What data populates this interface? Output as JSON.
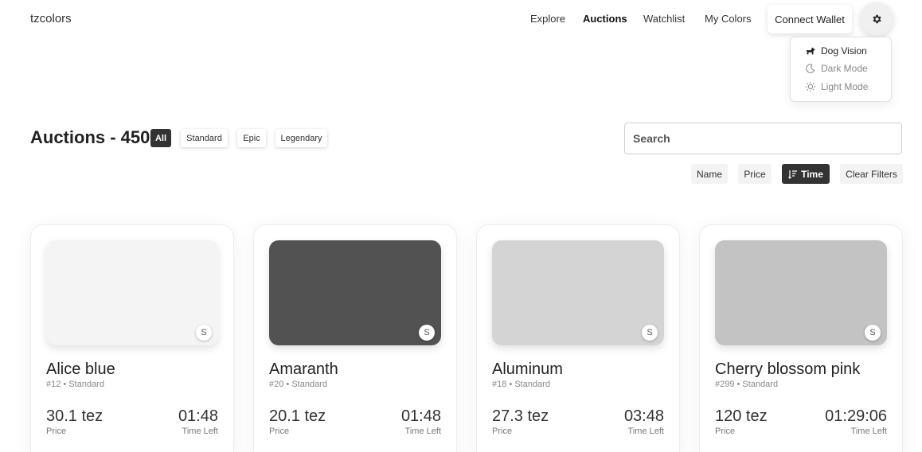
{
  "app": {
    "logo": "tzcolors"
  },
  "nav": {
    "explore": "Explore",
    "auctions": "Auctions",
    "watchlist": "Watchlist",
    "my_colors": "My Colors",
    "connect_wallet": "Connect Wallet",
    "settings_icon": "gear-icon"
  },
  "settings_menu": {
    "items": [
      {
        "label": "Dog Vision",
        "icon": "dog-icon"
      },
      {
        "label": "Dark Mode",
        "icon": "moon-icon"
      },
      {
        "label": "Light Mode",
        "icon": "sun-icon"
      }
    ]
  },
  "auctions": {
    "title": "Auctions - ",
    "count": "450",
    "filters": [
      "All",
      "Standard",
      "Epic",
      "Legendary"
    ],
    "active_filter": "All"
  },
  "search": {
    "placeholder": "Search",
    "value": ""
  },
  "sort": {
    "options": [
      "Name",
      "Price",
      "Time"
    ],
    "active": "Time",
    "clear_label": "Clear Filters"
  },
  "cards": [
    {
      "name": "Alice blue",
      "meta": "#12 • Standard",
      "price": "30.1 tez",
      "price_label": "Price",
      "time": "01:48",
      "time_label": "Time Left",
      "badge": "S",
      "color": "#f4f4f4"
    },
    {
      "name": "Amaranth",
      "meta": "#20 • Standard",
      "price": "20.1 tez",
      "price_label": "Price",
      "time": "01:48",
      "time_label": "Time Left",
      "badge": "S",
      "color": "#525252"
    },
    {
      "name": "Aluminum",
      "meta": "#18 • Standard",
      "price": "27.3 tez",
      "price_label": "Price",
      "time": "03:48",
      "time_label": "Time Left",
      "badge": "S",
      "color": "#d4d4d4"
    },
    {
      "name": "Cherry blossom pink",
      "meta": "#299 • Standard",
      "price": "120 tez",
      "price_label": "Price",
      "time": "01:29:06",
      "time_label": "Time Left",
      "badge": "S",
      "color": "#c3c3c3"
    }
  ]
}
